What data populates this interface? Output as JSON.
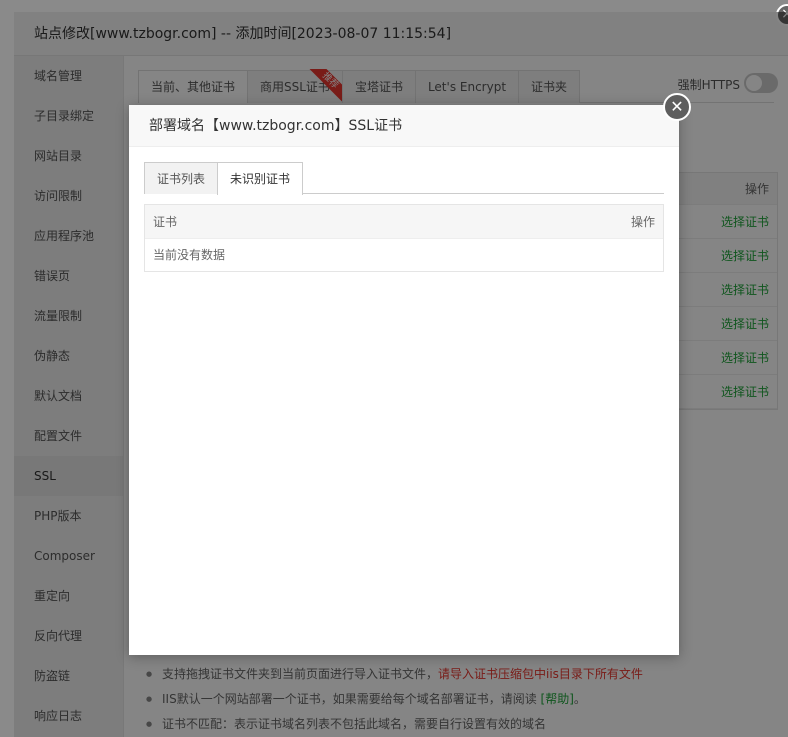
{
  "outer": {
    "title": "站点修改[www.tzbogr.com] -- 添加时间[2023-08-07 11:15:54]",
    "close_glyph": "×",
    "sidebar": [
      "域名管理",
      "子目录绑定",
      "网站目录",
      "访问限制",
      "应用程序池",
      "错误页",
      "流量限制",
      "伪静态",
      "默认文档",
      "配置文件",
      "SSL",
      "PHP版本",
      "Composer",
      "重定向",
      "反向代理",
      "防盗链",
      "响应日志"
    ],
    "active_sidebar": "SSL",
    "tabs": [
      "当前、其他证书",
      "商用SSL证书",
      "宝塔证书",
      "Let's Encrypt",
      "证书夹"
    ],
    "ribbon": "推荐",
    "force_https": "强制HTTPS",
    "table": {
      "op_header": "操作",
      "rows": [
        "选择证书",
        "选择证书",
        "选择证书",
        "选择证书",
        "选择证书",
        "选择证书"
      ]
    },
    "notes": {
      "n1_prefix": "支持拖拽证书文件夹到当前页面进行导入证书文件，",
      "n1_red": "请导入证书压缩包中iis目录下所有文件",
      "n2_prefix": "IIS默认一个网站部署一个证书，如果需要给每个域名部署证书，请阅读 ",
      "n2_link": "[帮助]",
      "n2_suffix": "。",
      "n3": "证书不匹配：表示证书域名列表不包括此域名，需要自行设置有效的域名"
    }
  },
  "modal": {
    "title": "部署域名【www.tzbogr.com】SSL证书",
    "close_glyph": "✕",
    "tabs": [
      "证书列表",
      "未识别证书"
    ],
    "active_tab": "未识别证书",
    "table": {
      "col_cert": "证书",
      "col_op": "操作",
      "empty": "当前没有数据"
    }
  }
}
